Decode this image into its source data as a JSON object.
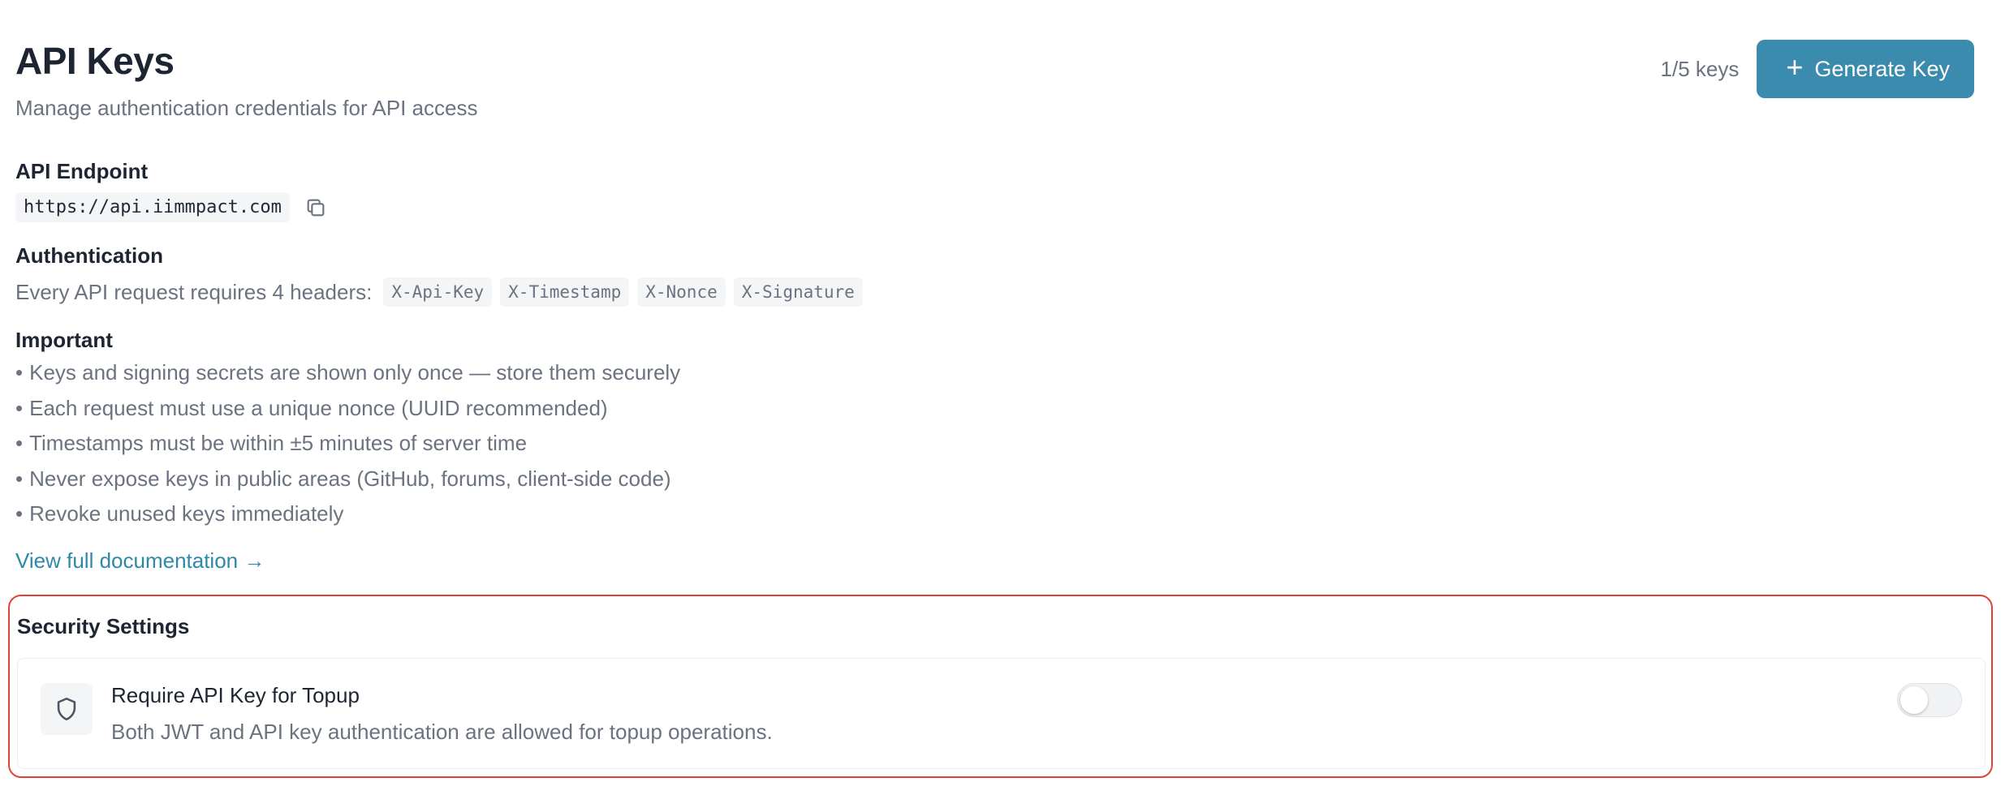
{
  "header": {
    "title": "API Keys",
    "subtitle": "Manage authentication credentials for API access",
    "key_count": "1/5 keys",
    "generate_label": "Generate Key"
  },
  "endpoint": {
    "label": "API Endpoint",
    "url": "https://api.iimmpact.com"
  },
  "authentication": {
    "label": "Authentication",
    "lead": "Every API request requires 4 headers:",
    "headers": [
      "X-Api-Key",
      "X-Timestamp",
      "X-Nonce",
      "X-Signature"
    ]
  },
  "important": {
    "label": "Important",
    "items": [
      "Keys and signing secrets are shown only once — store them securely",
      "Each request must use a unique nonce (UUID recommended)",
      "Timestamps must be within ±5 minutes of server time",
      "Never expose keys in public areas (GitHub, forums, client-side code)",
      "Revoke unused keys immediately"
    ]
  },
  "docs_link": "View full documentation →",
  "security": {
    "title": "Security Settings",
    "setting_title": "Require API Key for Topup",
    "setting_desc": "Both JWT and API key authentication are allowed for topup operations.",
    "toggle_on": false
  },
  "colors": {
    "accent": "#3a8bad",
    "link": "#2e88a8",
    "highlight_border": "#e34234"
  },
  "icons": {
    "copy": "copy-icon",
    "shield": "shield-icon",
    "plus": "plus-icon"
  }
}
